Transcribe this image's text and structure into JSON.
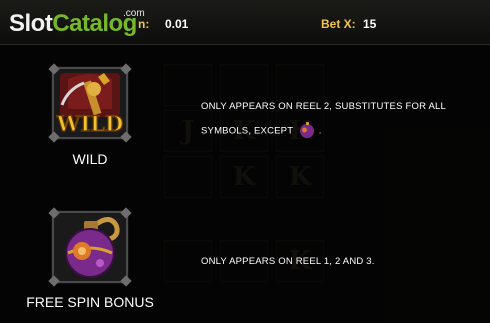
{
  "header": {
    "logo_text_1": "Slot",
    "logo_text_2": "Catalog",
    "logo_com": ".com",
    "coin_label": "n:",
    "coin_value": "0.01",
    "bet_label": "Bet X:",
    "bet_value": "15"
  },
  "background": {
    "reel_letters": [
      "J",
      "K",
      "K",
      "K",
      "K",
      "K"
    ]
  },
  "symbols": [
    {
      "name": "WILD",
      "logo_text": "WILD",
      "description_line1": "ONLY APPEARS ON REEL 2, SUBSTITUTES FOR ALL",
      "description_line2_prefix": "SYMBOLS, EXCEPT",
      "description_line2_suffix": ".",
      "icon": "wild-hammer-icon"
    },
    {
      "name": "FREE SPIN BONUS",
      "description_line1": "ONLY APPEARS ON REEL 1, 2 AND 3.",
      "icon": "purple-bomb-icon"
    }
  ],
  "colors": {
    "logo_green": "#76b82a",
    "label_gold": "#f0c64a",
    "wild_gold": "#f2c230",
    "bomb_purple": "#7a2a8a"
  }
}
